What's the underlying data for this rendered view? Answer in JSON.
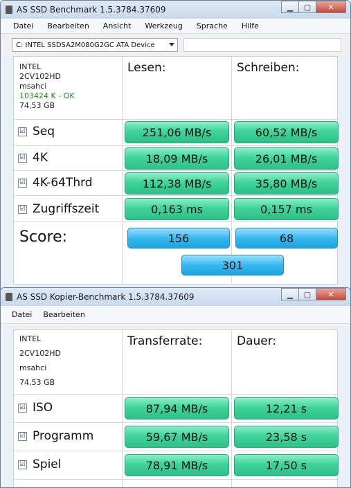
{
  "window1": {
    "title": "AS SSD Benchmark 1.5.3784.37609",
    "menu": [
      "Datei",
      "Bearbeiten",
      "Ansicht",
      "Werkzeug",
      "Sprache",
      "Hilfe"
    ],
    "device": "C: INTEL SSDSA2M080G2GC ATA Device",
    "info": {
      "name": "INTEL",
      "id": "2CV102HD",
      "driver": "msahci",
      "align": "103424 K - OK",
      "size": "74,53 GB"
    },
    "header": {
      "read": "Lesen:",
      "write": "Schreiben:"
    },
    "rows": [
      {
        "label": "Seq",
        "read": "251,06 MB/s",
        "write": "60,52 MB/s"
      },
      {
        "label": "4K",
        "read": "18,09 MB/s",
        "write": "26,01 MB/s"
      },
      {
        "label": "4K-64Thrd",
        "read": "112,38 MB/s",
        "write": "35,80 MB/s"
      },
      {
        "label": "Zugriffszeit",
        "read": "0,163 ms",
        "write": "0,157 ms"
      }
    ],
    "score": {
      "label": "Score:",
      "read": "156",
      "write": "68",
      "total": "301"
    }
  },
  "window2": {
    "title": "AS SSD Kopier-Benchmark 1.5.3784.37609",
    "menu": [
      "Datei",
      "Bearbeiten"
    ],
    "info": {
      "name": "INTEL",
      "id": "2CV102HD",
      "driver": "msahci",
      "size": "74,53 GB"
    },
    "header": {
      "rate": "Transferrate:",
      "time": "Dauer:"
    },
    "rows": [
      {
        "label": "ISO",
        "rate": "87,94 MB/s",
        "time": "12,21 s"
      },
      {
        "label": "Programm",
        "rate": "59,67 MB/s",
        "time": "23,58 s"
      },
      {
        "label": "Spiel",
        "rate": "78,91 MB/s",
        "time": "17,50 s"
      }
    ]
  },
  "checkbox_mark": "☑",
  "colors": {
    "value_green": "#3fd39a",
    "score_blue": "#37b8ee",
    "ok_green": "#1b8c1b"
  }
}
